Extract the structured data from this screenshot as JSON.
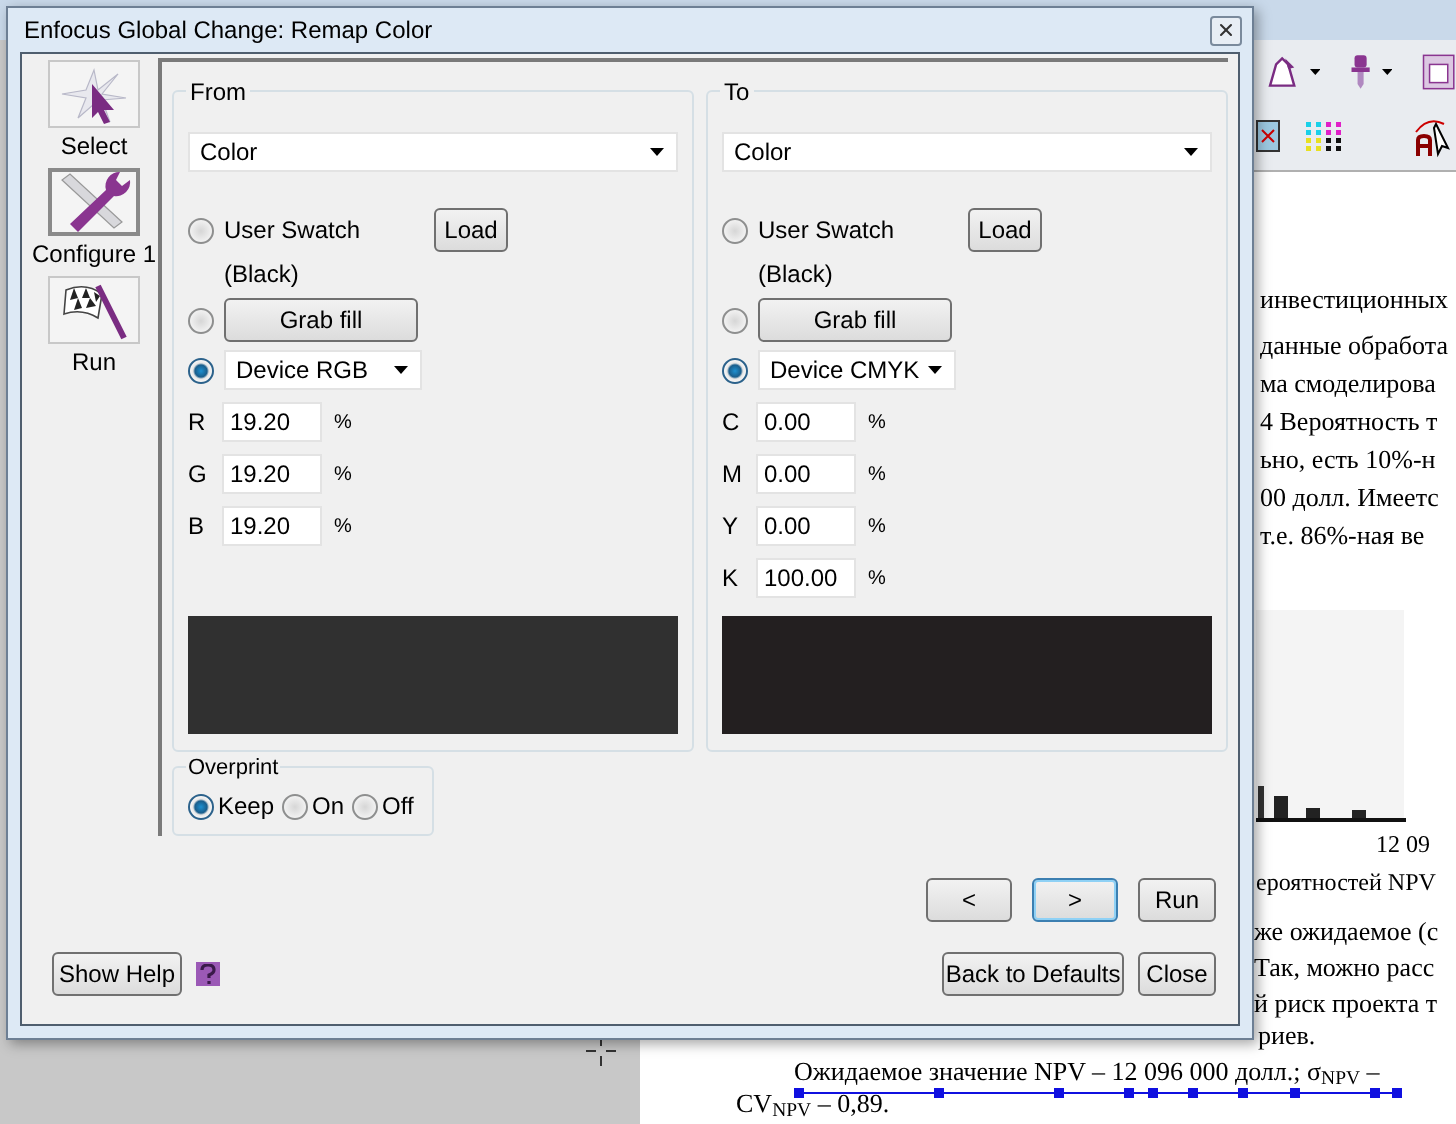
{
  "window": {
    "title": "Enfocus Global Change: Remap Color"
  },
  "tools": [
    {
      "kind": "select",
      "label": "Select",
      "selected": false
    },
    {
      "kind": "configure",
      "label": "Configure 1",
      "selected": true
    },
    {
      "kind": "run",
      "label": "Run",
      "selected": false
    }
  ],
  "panels": [
    {
      "title": "From",
      "type_select": "Color",
      "swatch": {
        "label": "User Swatch",
        "button": "Load",
        "note": "(Black)",
        "selected": false
      },
      "grab": {
        "button": "Grab fill",
        "selected": false
      },
      "space": {
        "value": "Device RGB",
        "selected": true
      },
      "channels": [
        {
          "label": "R",
          "value": "19.20",
          "unit": "%"
        },
        {
          "label": "G",
          "value": "19.20",
          "unit": "%"
        },
        {
          "label": "B",
          "value": "19.20",
          "unit": "%"
        }
      ],
      "preview": {
        "color": "#303030"
      }
    },
    {
      "title": "To",
      "type_select": "Color",
      "swatch": {
        "label": "User Swatch",
        "button": "Load",
        "note": "(Black)",
        "selected": false
      },
      "grab": {
        "button": "Grab fill",
        "selected": false
      },
      "space": {
        "value": "Device CMYK",
        "selected": true
      },
      "channels": [
        {
          "label": "C",
          "value": "0.00",
          "unit": "%"
        },
        {
          "label": "M",
          "value": "0.00",
          "unit": "%"
        },
        {
          "label": "Y",
          "value": "0.00",
          "unit": "%"
        },
        {
          "label": "K",
          "value": "100.00",
          "unit": "%"
        }
      ],
      "preview": {
        "color": "#231f20"
      }
    }
  ],
  "overprint": {
    "title": "Overprint",
    "options": [
      {
        "label": "Keep",
        "selected": true
      },
      {
        "label": "On",
        "selected": false
      },
      {
        "label": "Off",
        "selected": false
      }
    ]
  },
  "nav_buttons": [
    {
      "label": "<",
      "focused": false
    },
    {
      "label": ">",
      "focused": true
    },
    {
      "label": "Run",
      "focused": false
    }
  ],
  "help_button": "Show Help",
  "bottom_buttons": [
    {
      "label": "Back to Defaults"
    },
    {
      "label": "Close"
    }
  ],
  "document": {
    "heading": "инвестиционных",
    "paragraph_1": [
      "данные обработа",
      "ма смоделирова",
      "4 Вероятность т",
      "ьно, есть 10%-н",
      "00 долл. Имеетс",
      "т.е. 86%-ная ве"
    ],
    "axis_label": "12 09",
    "caption": "ероятностей NPV",
    "paragraph_2": [
      "же ожидаемое (с",
      "Так, можно расс",
      "й риск проекта т",
      "риев."
    ],
    "paragraph_3": [
      "Ожидаемое значение NPV – 12 096 000 долл.; σ$_{NPV}$ –",
      "CV$_{NPV}$ – 0,89."
    ]
  }
}
